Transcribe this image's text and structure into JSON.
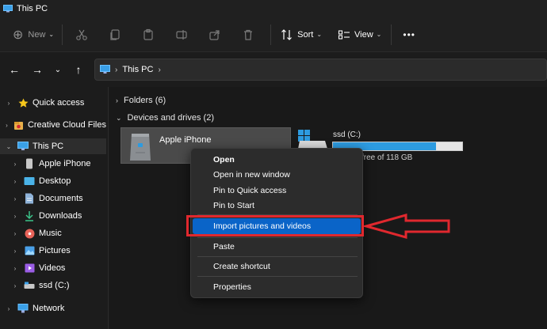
{
  "window": {
    "title": "This PC"
  },
  "toolbar": {
    "new_label": "New",
    "sort_label": "Sort",
    "view_label": "View",
    "more_label": "•••"
  },
  "address": {
    "crumbs": [
      "This PC"
    ]
  },
  "sidebar": {
    "items": [
      {
        "label": "Quick access",
        "icon": "star-icon"
      },
      {
        "label": "Creative Cloud Files",
        "icon": "creative-cloud-icon"
      },
      {
        "label": "This PC",
        "icon": "monitor-icon"
      },
      {
        "label": "Apple iPhone",
        "icon": "phone-icon"
      },
      {
        "label": "Desktop",
        "icon": "desktop-icon"
      },
      {
        "label": "Documents",
        "icon": "documents-icon"
      },
      {
        "label": "Downloads",
        "icon": "download-icon"
      },
      {
        "label": "Music",
        "icon": "music-icon"
      },
      {
        "label": "Pictures",
        "icon": "pictures-icon"
      },
      {
        "label": "Videos",
        "icon": "videos-icon"
      },
      {
        "label": "ssd (C:)",
        "icon": "drive-icon"
      },
      {
        "label": "Network",
        "icon": "network-icon"
      }
    ]
  },
  "main": {
    "folders_header": "Folders (6)",
    "devices_header": "Devices and drives (2)",
    "device_tile": {
      "label": "Apple iPhone"
    },
    "drive": {
      "name": "ssd (C:)",
      "free_text": "free of 118 GB",
      "used_fraction": 0.8
    }
  },
  "context_menu": {
    "items": [
      {
        "label": "Open"
      },
      {
        "label": "Open in new window"
      },
      {
        "label": "Pin to Quick access"
      },
      {
        "label": "Pin to Start"
      },
      {
        "label": "Import pictures and videos"
      },
      {
        "label": "Paste"
      },
      {
        "label": "Create shortcut"
      },
      {
        "label": "Properties"
      }
    ]
  },
  "colors": {
    "accent": "#0a64c8",
    "annotation_red": "#e0282e",
    "drive_fill": "#2d9be0"
  }
}
